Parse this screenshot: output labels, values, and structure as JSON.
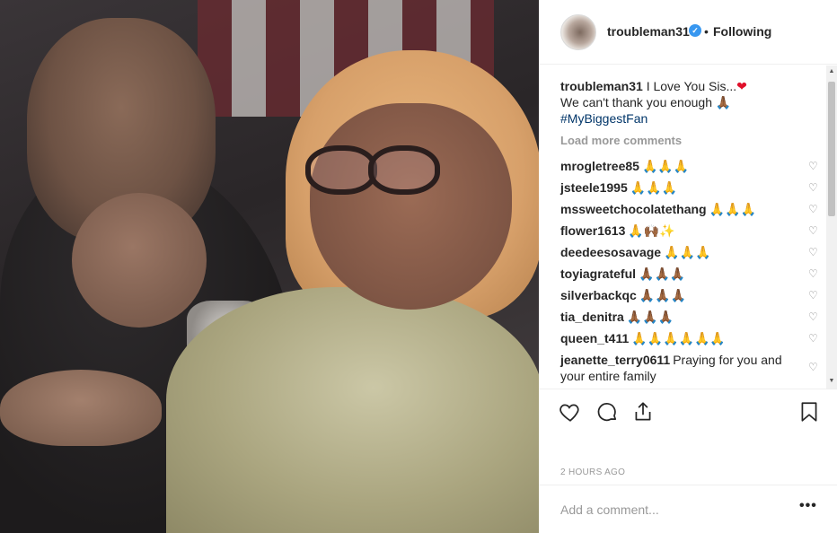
{
  "post": {
    "image_alt": "",
    "colors": {
      "accent": "#3897f0",
      "hashtag": "#003569",
      "muted": "#999999"
    }
  },
  "header": {
    "username": "troubleman31",
    "verified_icon": "verified-badge-icon",
    "separator": "•",
    "follow_status": "Following"
  },
  "caption": {
    "username": "troubleman31",
    "line1": "I Love You Sis...",
    "heart": "❤",
    "line2": "We can't thank you enough 🙏🏾",
    "hashtag": "#MyBiggestFan"
  },
  "load_more": "Load more comments",
  "comments": [
    {
      "user": "mrogletree85",
      "text": "🙏🙏🙏"
    },
    {
      "user": "jsteele1995",
      "text": "🙏🙏🙏"
    },
    {
      "user": "mssweetchocolatethang",
      "text": "🙏🙏🙏"
    },
    {
      "user": "flower1613",
      "text": "🙏🙌🏾✨"
    },
    {
      "user": "deedeesosavage",
      "text": "🙏🙏🙏"
    },
    {
      "user": "toyiagrateful",
      "text": "🙏🏾🙏🏾🙏🏾"
    },
    {
      "user": "silverbackqc",
      "text": "🙏🏾🙏🏾🙏🏾"
    },
    {
      "user": "tia_denitra",
      "text": "🙏🏾🙏🏾🙏🏾"
    },
    {
      "user": "queen_t411",
      "text": "🙏🙏🙏🙏🙏🙏"
    },
    {
      "user": "jeanette_terry0611",
      "text": "Praying for you and your entire family"
    }
  ],
  "actions": {
    "like_icon": "heart-outline-icon",
    "comment_icon": "comment-bubble-icon",
    "share_icon": "share-icon",
    "save_icon": "bookmark-icon"
  },
  "timestamp": "2 HOURS AGO",
  "add_comment": {
    "placeholder": "Add a comment...",
    "more": "•••"
  }
}
